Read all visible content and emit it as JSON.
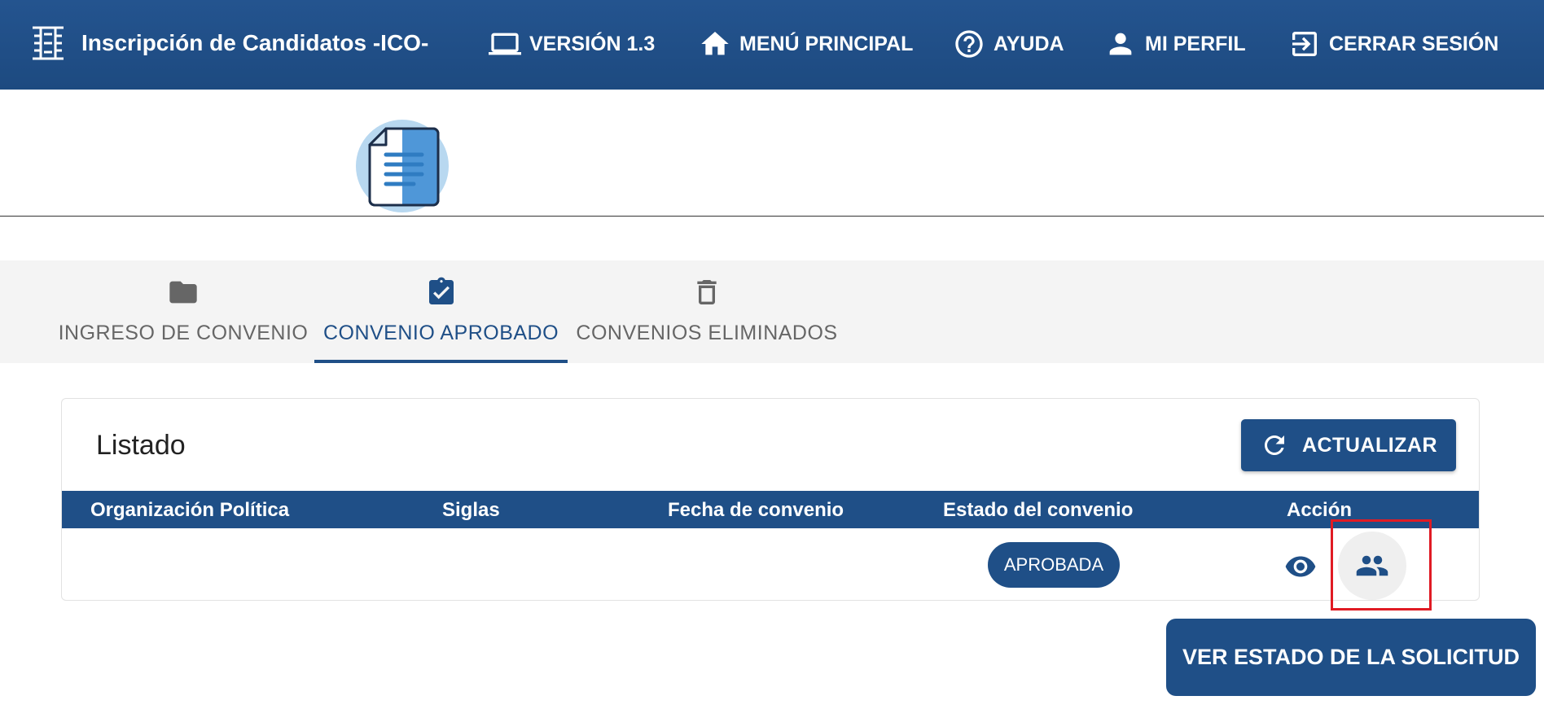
{
  "app": {
    "title": "Inscripción de Candidatos -ICO-",
    "logo_icon": "ico-logo-icon"
  },
  "nav": [
    {
      "label": "VERSIÓN 1.3",
      "icon": "laptop-icon"
    },
    {
      "label": "MENÚ PRINCIPAL",
      "icon": "home-icon"
    },
    {
      "label": "AYUDA",
      "icon": "help-circle-icon"
    },
    {
      "label": "MI PERFIL",
      "icon": "person-icon"
    },
    {
      "label": "CERRAR SESIÓN",
      "icon": "logout-icon"
    }
  ],
  "header": {
    "icon": "document-icon"
  },
  "tabs": [
    {
      "label": "INGRESO DE CONVENIO",
      "icon": "folder-icon",
      "active": false
    },
    {
      "label": "CONVENIO APROBADO",
      "icon": "clipboard-check-icon",
      "active": true
    },
    {
      "label": "CONVENIOS ELIMINADOS",
      "icon": "trash-icon",
      "active": false
    }
  ],
  "listado": {
    "title": "Listado",
    "refresh_label": "ACTUALIZAR",
    "columns": [
      "Organización Política",
      "Siglas",
      "Fecha de convenio",
      "Estado del convenio",
      "Acción"
    ],
    "rows": [
      {
        "organizacion": "",
        "siglas": "",
        "fecha": "",
        "estado": "APROBADA"
      }
    ]
  },
  "tooltip": {
    "text": "VER ESTADO DE LA SOLICITUD"
  },
  "colors": {
    "primary": "#1f4f87",
    "topbar": "#24548f",
    "tab_bar": "#f4f4f4",
    "highlight": "#e01b24"
  }
}
